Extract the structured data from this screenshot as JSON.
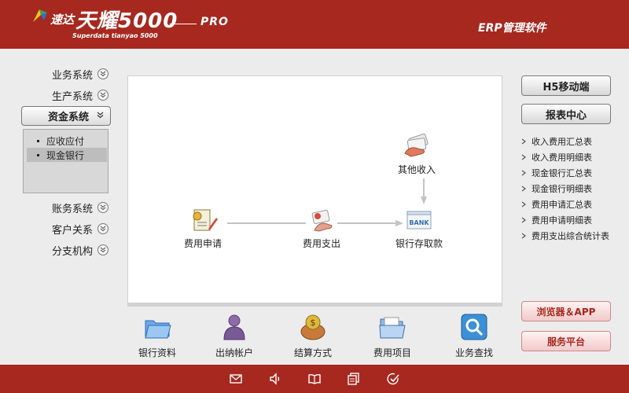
{
  "header": {
    "brand_cn": "速达",
    "brand_main": "天耀5000",
    "brand_pro": "PRO",
    "brand_sub": "Superdata tianyao 5000",
    "erp_title": "ERP管理软件"
  },
  "nav": {
    "items_top": [
      {
        "label": "业务系统",
        "icon": "chevron-down-icon"
      },
      {
        "label": "生产系统",
        "icon": "chevron-down-icon"
      }
    ],
    "active": {
      "label": "资金系统",
      "icon": "chevron-down-icon"
    },
    "submenu": [
      {
        "label": "应收应付",
        "selected": false
      },
      {
        "label": "现金银行",
        "selected": true
      }
    ],
    "items_bottom": [
      {
        "label": "账务系统",
        "icon": "chevron-down-icon"
      },
      {
        "label": "客户关系",
        "icon": "chevron-down-icon"
      },
      {
        "label": "分支机构",
        "icon": "chevron-down-icon"
      }
    ]
  },
  "flow": {
    "other_income": "其他收入",
    "expense_apply": "费用申请",
    "expense_pay": "费用支出",
    "bank_deposit": "银行存取款",
    "bank_label": "BANK"
  },
  "tools": [
    {
      "label": "银行资料",
      "icon": "folder-icon"
    },
    {
      "label": "出纳帐户",
      "icon": "user-icon"
    },
    {
      "label": "结算方式",
      "icon": "money-bag-icon"
    },
    {
      "label": "费用项目",
      "icon": "folder-open-icon"
    },
    {
      "label": "业务查找",
      "icon": "search-icon"
    }
  ],
  "right": {
    "h5_btn": "H5移动端",
    "report_btn": "报表中心",
    "reports": [
      "收入费用汇总表",
      "收入费用明细表",
      "现金银行汇总表",
      "现金银行明细表",
      "费用申请汇总表",
      "费用申请明细表",
      "费用支出综合统计表"
    ],
    "browser_btn": "浏览器＆APP",
    "service_btn": "服务平台"
  },
  "footer_icons": [
    "mail-icon",
    "speaker-icon",
    "book-icon",
    "copy-icon",
    "check-icon"
  ],
  "colors": {
    "brand": "#a6281f",
    "panel": "#ffffff",
    "background": "#ececec"
  }
}
